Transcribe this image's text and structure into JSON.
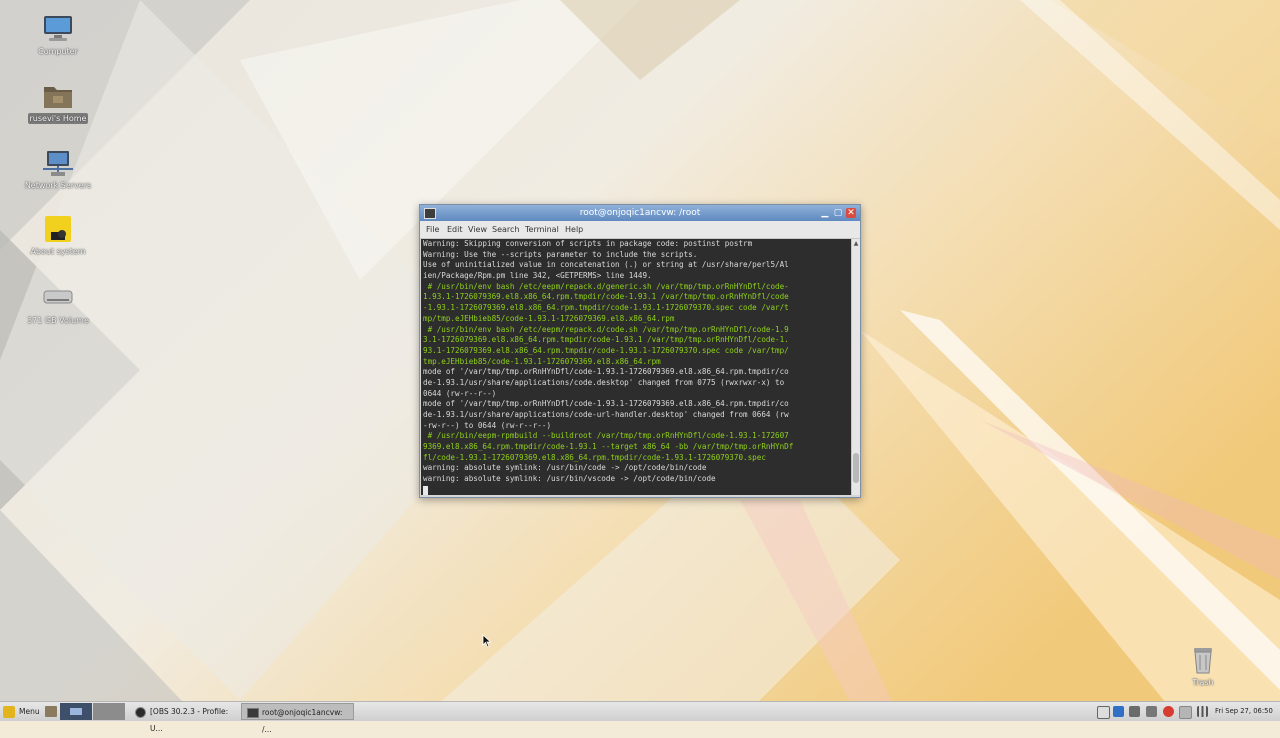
{
  "desktop": {
    "icons": [
      {
        "label": "Computer",
        "icon": "computer-icon"
      },
      {
        "label": "rusevi's Home",
        "icon": "home-folder-icon"
      },
      {
        "label": "Network Servers",
        "icon": "network-servers-icon"
      },
      {
        "label": "About system",
        "icon": "basealt-logo-icon"
      },
      {
        "label": "371 GB Volume",
        "icon": "drive-volume-icon"
      },
      {
        "label": "Trash",
        "icon": "trash-icon"
      }
    ]
  },
  "terminal": {
    "title": "root@onjoqic1ancvw: /root",
    "menu": [
      "File",
      "Edit",
      "View",
      "Search",
      "Terminal",
      "Help"
    ],
    "lines": [
      {
        "type": "warn",
        "text": "Warning: Skipping conversion of scripts in package code: postinst postrm"
      },
      {
        "type": "warn",
        "text": "Warning: Use the --scripts parameter to include the scripts."
      },
      {
        "type": "warn",
        "text": "Use of uninitialized value in concatenation (.) or string at /usr/share/perl5/Al"
      },
      {
        "type": "warn",
        "text": "ien/Package/Rpm.pm line 342, <GETPERMS> line 1449."
      },
      {
        "type": "cmd",
        "text": " # /usr/bin/env bash /etc/eepm/repack.d/generic.sh /var/tmp/tmp.orRnHYnDfl/code-"
      },
      {
        "type": "cmd",
        "text": "1.93.1-1726079369.el8.x86_64.rpm.tmpdir/code-1.93.1 /var/tmp/tmp.orRnHYnDfl/code"
      },
      {
        "type": "cmd",
        "text": "-1.93.1-1726079369.el8.x86_64.rpm.tmpdir/code-1.93.1-1726079370.spec code /var/t"
      },
      {
        "type": "cmd",
        "text": "mp/tmp.eJEHbieb85/code-1.93.1-1726079369.el8.x86_64.rpm"
      },
      {
        "type": "cmd",
        "text": " # /usr/bin/env bash /etc/eepm/repack.d/code.sh /var/tmp/tmp.orRnHYnDfl/code-1.9"
      },
      {
        "type": "cmd",
        "text": "3.1-1726079369.el8.x86_64.rpm.tmpdir/code-1.93.1 /var/tmp/tmp.orRnHYnDfl/code-1."
      },
      {
        "type": "cmd",
        "text": "93.1-1726079369.el8.x86_64.rpm.tmpdir/code-1.93.1-1726079370.spec code /var/tmp/"
      },
      {
        "type": "cmd",
        "text": "tmp.eJEHbieb85/code-1.93.1-1726079369.el8.x86_64.rpm"
      },
      {
        "type": "warn",
        "text": "mode of '/var/tmp/tmp.orRnHYnDfl/code-1.93.1-1726079369.el8.x86_64.rpm.tmpdir/co"
      },
      {
        "type": "warn",
        "text": "de-1.93.1/usr/share/applications/code.desktop' changed from 0775 (rwxrwxr-x) to"
      },
      {
        "type": "warn",
        "text": "0644 (rw-r--r--)"
      },
      {
        "type": "warn",
        "text": "mode of '/var/tmp/tmp.orRnHYnDfl/code-1.93.1-1726079369.el8.x86_64.rpm.tmpdir/co"
      },
      {
        "type": "warn",
        "text": "de-1.93.1/usr/share/applications/code-url-handler.desktop' changed from 0664 (rw"
      },
      {
        "type": "warn",
        "text": "-rw-r--) to 0644 (rw-r--r--)"
      },
      {
        "type": "cmd",
        "text": " # /usr/bin/eepm-rpmbuild --buildroot /var/tmp/tmp.orRnHYnDfl/code-1.93.1-172607"
      },
      {
        "type": "cmd",
        "text": "9369.el8.x86_64.rpm.tmpdir/code-1.93.1 --target x86_64 -bb /var/tmp/tmp.orRnHYnDf"
      },
      {
        "type": "cmd",
        "text": "fl/code-1.93.1-1726079369.el8.x86_64.rpm.tmpdir/code-1.93.1-1726079370.spec"
      },
      {
        "type": "warn",
        "text": "warning: absolute symlink: /usr/bin/code -> /opt/code/bin/code"
      },
      {
        "type": "warn",
        "text": "warning: absolute symlink: /usr/bin/vscode -> /opt/code/bin/code"
      }
    ]
  },
  "taskbar": {
    "menu_label": "Menu",
    "tasks": [
      {
        "label": "[OBS 30.2.3 - Profile: U...",
        "icon": "obs-icon"
      },
      {
        "label": "root@onjoqic1ancvw: /...",
        "icon": "terminal-icon"
      }
    ],
    "clock": "Fri Sep 27, 06:50"
  },
  "colors": {
    "terminal_bg": "#2d2d2d",
    "terminal_green": "#8fd11a",
    "titlebar": "#6d94c8"
  }
}
